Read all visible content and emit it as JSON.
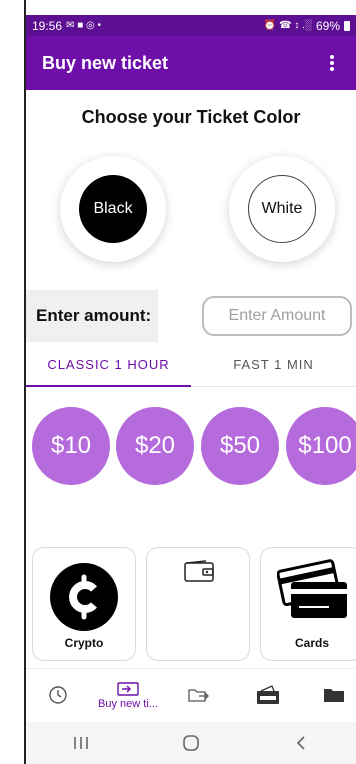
{
  "status_bar": {
    "time": "19:56",
    "left_icons": "✉ ■ ◎ •",
    "right_icons": "⏰ ☎ ↕ .░",
    "battery": "69%"
  },
  "app_bar": {
    "title": "Buy new ticket"
  },
  "ticket_color": {
    "heading": "Choose your Ticket Color",
    "options": [
      "Black",
      "White"
    ]
  },
  "amount": {
    "label": "Enter amount:",
    "placeholder": "Enter Amount"
  },
  "tabs": [
    {
      "label": "CLASSIC 1 HOUR",
      "active": true
    },
    {
      "label": "FAST 1 MIN",
      "active": false
    }
  ],
  "prices": [
    "$10",
    "$20",
    "$50",
    "$100"
  ],
  "payment_methods": [
    {
      "label": "Crypto",
      "icon": "crypto-coin-icon"
    },
    {
      "label": "",
      "icon": "wallet-icon"
    },
    {
      "label": "Cards",
      "icon": "credit-cards-icon"
    }
  ],
  "bottom_nav": [
    {
      "label": "",
      "icon": "history-clock-icon"
    },
    {
      "label": "Buy new ti...",
      "icon": "buy-ticket-icon"
    },
    {
      "label": "",
      "icon": "transfer-icon"
    },
    {
      "label": "",
      "icon": "wallet-cash-icon"
    },
    {
      "label": "",
      "icon": "folder-icon"
    }
  ],
  "colors": {
    "app_bar": "#6d0fa8",
    "status_bar": "#5d0f94",
    "price_chip": "#b56bdc",
    "accent": "#6d0fa8"
  }
}
